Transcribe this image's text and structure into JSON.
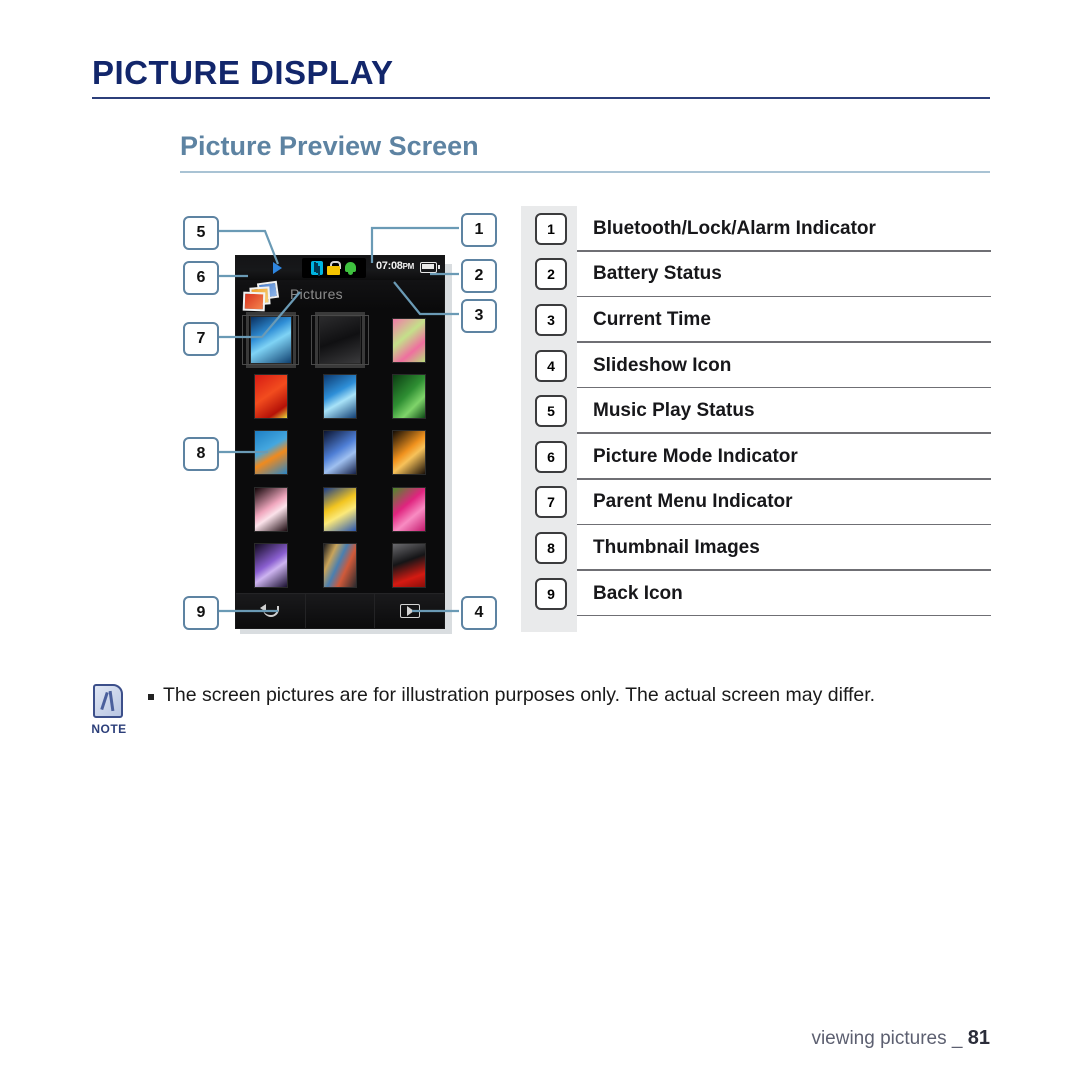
{
  "header": {
    "title": "PICTURE DISPLAY",
    "subtitle": "Picture Preview Screen"
  },
  "colors": {
    "title": "#12266b",
    "subtitle": "#5d83a2",
    "callout_border": "#5d83a2",
    "legend_strip": "#e9eaeb",
    "note_accent": "#2c3f7a"
  },
  "device": {
    "status_bar": {
      "music_play_icon": "play-triangle-icon",
      "bluetooth_icon": "bluetooth-icon",
      "lock_icon": "lock-icon",
      "alarm_icon": "alarm-bell-icon",
      "time": "07:08",
      "ampm": "PM",
      "battery_icon": "battery-icon"
    },
    "title_bar": {
      "picture_mode_icon": "picture-stack-icon",
      "parent_menu_label": "Pictures"
    },
    "thumbnails": [
      {
        "name": "blue-fern",
        "gradient": "linear-gradient(150deg,#0a2f5e 0%,#2f8ed6 35%,#7fd3f5 55%,#10406f 100%)",
        "selected": true
      },
      {
        "name": "dark-document",
        "gradient": "linear-gradient(160deg,#2b2b2d 0%,#101012 50%,#3a3a3c 100%)",
        "selected": true
      },
      {
        "name": "pink-berries",
        "gradient": "linear-gradient(140deg,#f07ba8 0%,#c4e08a 40%,#ef6f9f 70%,#b8dd7c 100%)",
        "selected": false
      },
      {
        "name": "red-strawberries",
        "gradient": "linear-gradient(145deg,#d61b14 0%,#f24c1e 45%,#b51208 80%,#e8d93a 100%)",
        "selected": false
      },
      {
        "name": "blue-feather",
        "gradient": "linear-gradient(150deg,#0d3a70 0%,#2e8fd8 40%,#a8e2f8 60%,#123f74 100%)",
        "selected": false
      },
      {
        "name": "green-leaf",
        "gradient": "linear-gradient(135deg,#0b3d12 0%,#2f8f33 45%,#7fd46a 70%,#0d4a16 100%)",
        "selected": false
      },
      {
        "name": "orange-starfish",
        "gradient": "linear-gradient(150deg,#1e7fc4 0%,#44a7df 40%,#f08a1e 60%,#2b86c6 100%)",
        "selected": false
      },
      {
        "name": "blue-hydrangea",
        "gradient": "linear-gradient(145deg,#0b1430 0%,#4f7fd6 45%,#9fc0f0 65%,#16224a 100%)",
        "selected": false
      },
      {
        "name": "orange-butterfly",
        "gradient": "linear-gradient(140deg,#120c06 0%,#f0921e 45%,#f7c25a 60%,#1a1008 100%)",
        "selected": false
      },
      {
        "name": "pink-petal",
        "gradient": "linear-gradient(145deg,#120508 0%,#f0a7be 45%,#fbe2ea 60%,#1d0a10 100%)",
        "selected": false
      },
      {
        "name": "yellow-tulip",
        "gradient": "linear-gradient(150deg,#1b3e8c 0%,#f2c520 40%,#fbe97a 60%,#2a56b0 100%)",
        "selected": false
      },
      {
        "name": "magenta-dahlia",
        "gradient": "linear-gradient(140deg,#4d8a2a 0%,#e0247f 40%,#f88cc2 65%,#c41a6e 100%)",
        "selected": false
      },
      {
        "name": "purple-crocus",
        "gradient": "linear-gradient(145deg,#120a20 0%,#8a5fd0 45%,#cdb4f0 60%,#1a1030 100%)",
        "selected": false
      },
      {
        "name": "striped-building",
        "gradient": "linear-gradient(115deg,#1b1b1f 0%,#c9a45a 25%,#4a7fb0 45%,#d05a3a 65%,#2a2a2e 100%)",
        "selected": false
      },
      {
        "name": "red-car-grille",
        "gradient": "linear-gradient(160deg,#6a6a6e 0%,#151517 40%,#d41a12 75%,#8a0f0a 100%)",
        "selected": false
      }
    ],
    "bottom_bar": {
      "back_icon": "back-arrow-icon",
      "slideshow_icon": "slideshow-play-icon"
    }
  },
  "callouts": [
    {
      "number": "5"
    },
    {
      "number": "6"
    },
    {
      "number": "7"
    },
    {
      "number": "8"
    },
    {
      "number": "9"
    },
    {
      "number": "1"
    },
    {
      "number": "2"
    },
    {
      "number": "3"
    },
    {
      "number": "4"
    }
  ],
  "legend": {
    "rows": [
      {
        "number": "1",
        "label": "Bluetooth/Lock/Alarm Indicator"
      },
      {
        "number": "2",
        "label": "Battery Status"
      },
      {
        "number": "3",
        "label": "Current Time"
      },
      {
        "number": "4",
        "label": "Slideshow Icon"
      },
      {
        "number": "5",
        "label": "Music Play Status"
      },
      {
        "number": "6",
        "label": "Picture Mode Indicator"
      },
      {
        "number": "7",
        "label": "Parent Menu Indicator"
      },
      {
        "number": "8",
        "label": "Thumbnail Images"
      },
      {
        "number": "9",
        "label": "Back Icon"
      }
    ]
  },
  "note": {
    "icon": "note-pen-icon",
    "caption": "NOTE",
    "text": "The screen pictures are for illustration purposes only. The actual screen may differ."
  },
  "footer": {
    "section": "viewing pictures _",
    "page": "81"
  }
}
